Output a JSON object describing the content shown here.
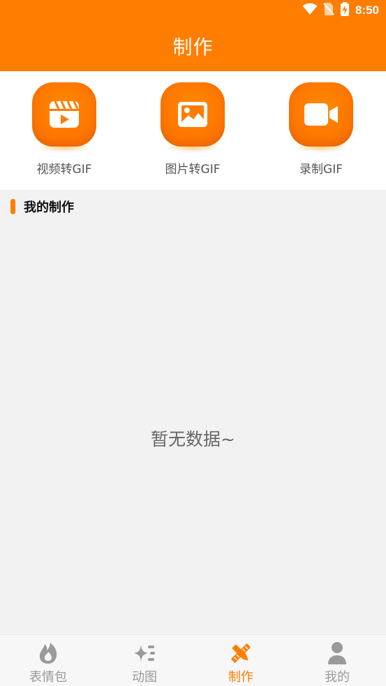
{
  "status_bar": {
    "time": "8:50",
    "icons": [
      "wifi-icon",
      "no-sim-icon",
      "battery-charging-icon"
    ]
  },
  "header": {
    "title": "制作"
  },
  "tools": [
    {
      "label": "视频转GIF",
      "icon": "video-clapper-icon"
    },
    {
      "label": "图片转GIF",
      "icon": "image-icon"
    },
    {
      "label": "录制GIF",
      "icon": "video-camera-icon"
    }
  ],
  "section": {
    "title": "我的制作"
  },
  "empty_state": {
    "text": "暂无数据~"
  },
  "bottom_nav": {
    "items": [
      {
        "label": "表情包",
        "icon": "flame-icon",
        "active": false
      },
      {
        "label": "动图",
        "icon": "sparkle-list-icon",
        "active": false
      },
      {
        "label": "制作",
        "icon": "pencil-ruler-icon",
        "active": true
      },
      {
        "label": "我的",
        "icon": "person-icon",
        "active": false
      }
    ]
  },
  "colors": {
    "accent": "#ff7d00",
    "inactive": "#9a9a9a",
    "background": "#f2f2f2"
  }
}
